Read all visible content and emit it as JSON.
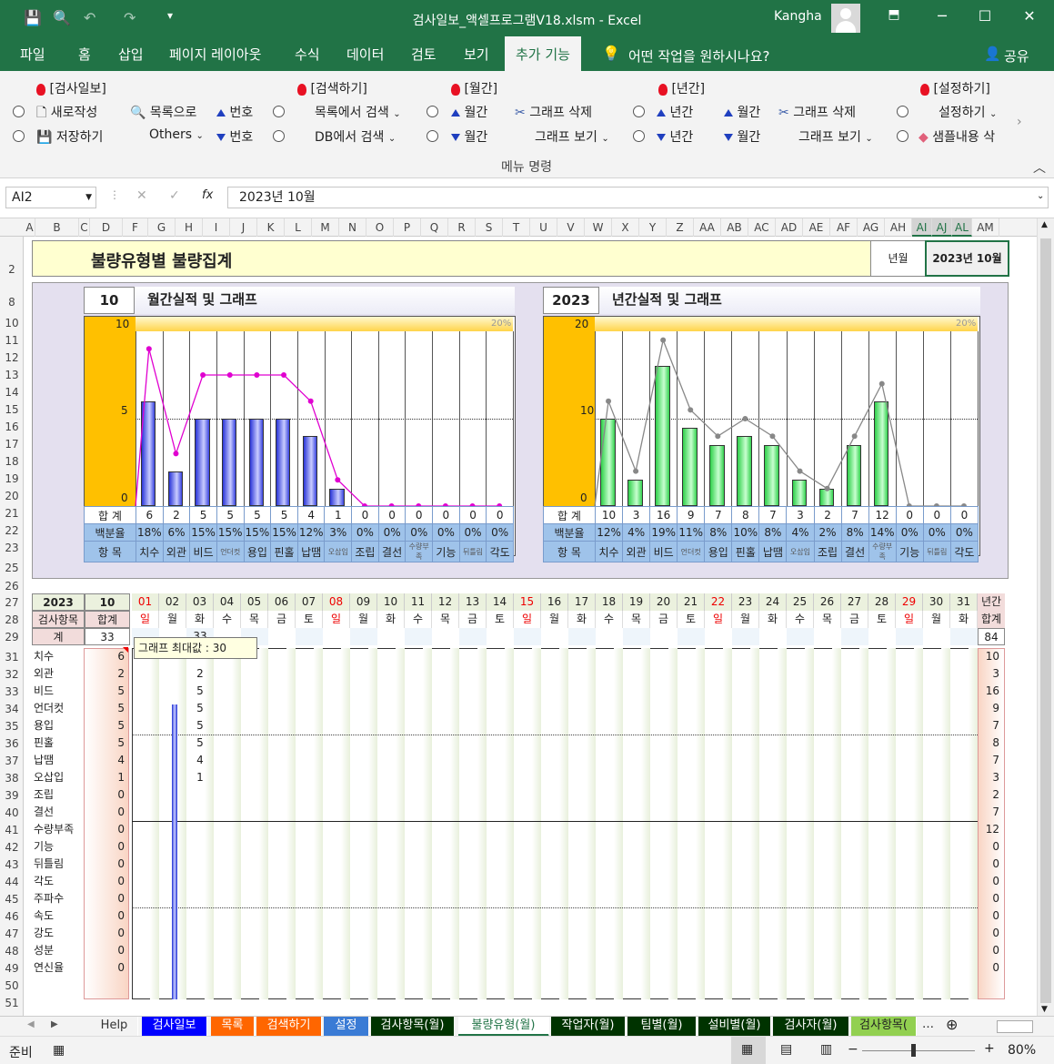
{
  "window": {
    "title": "검사일보_액셀프로그램V18.xlsm  -  Excel",
    "user": "Kangha"
  },
  "ribbon_tabs": [
    "파일",
    "홈",
    "삽입",
    "페이지 레이아웃",
    "수식",
    "데이터",
    "검토",
    "보기",
    "추가 기능"
  ],
  "tell_me": "어떤 작업을 원하시나요?",
  "share": "공유",
  "ribbon": {
    "g1_title": "[검사일보]",
    "new": "새로작성",
    "save": "저장하기",
    "to_list": "목록으로",
    "others": "Others",
    "num_up": "번호",
    "num_dn": "번호",
    "g2_title": "[검색하기]",
    "search_list": "목록에서 검색",
    "search_db": "DB에서 검색",
    "g3_title": "[월간]",
    "m_up": "월간",
    "m_dn": "월간",
    "graph_del": "그래프 삭제",
    "graph_view": "그래프 보기",
    "g4_title": "[년간]",
    "y_up": "년간",
    "y_dn": "년간",
    "ym_up": "월간",
    "ym_dn": "월간",
    "y_graph_del": "그래프 삭제",
    "y_graph_view": "그래프 보기",
    "g5_title": "[설정하기]",
    "settings": "설정하기",
    "sample_del": "샘플내용 삭",
    "footer": "메뉴 명령"
  },
  "formula": {
    "cell": "AI2",
    "value": "2023년 10월",
    "fx": "fx"
  },
  "columns": [
    "A",
    "B",
    "C",
    "D",
    "F",
    "G",
    "H",
    "I",
    "J",
    "K",
    "L",
    "M",
    "N",
    "O",
    "P",
    "Q",
    "R",
    "S",
    "T",
    "U",
    "V",
    "W",
    "X",
    "Y",
    "Z",
    "AA",
    "AB",
    "AC",
    "AD",
    "AE",
    "AF",
    "AG",
    "AH",
    "AI",
    "AJ",
    "AL",
    "AM"
  ],
  "rows": [
    "2",
    "8",
    "10",
    "11",
    "12",
    "13",
    "14",
    "15",
    "16",
    "17",
    "18",
    "19",
    "20",
    "21",
    "22",
    "23",
    "25",
    "26",
    "27",
    "28",
    "29",
    "31",
    "32",
    "33",
    "34",
    "35",
    "36",
    "37",
    "38",
    "39",
    "40",
    "41",
    "42",
    "43",
    "44",
    "45",
    "46",
    "47",
    "48",
    "49",
    "50",
    "51"
  ],
  "header": {
    "title": "불량유형별 불량집계",
    "ym_label": "년월",
    "ym_value": "2023년 10월"
  },
  "monthly": {
    "num": "10",
    "title": "월간실적 및 그래프",
    "ytop": "10",
    "ymid": "5",
    "y0": "0",
    "pct": "20%"
  },
  "yearly": {
    "num": "2023",
    "title": "년간실적 및 그래프",
    "ytop": "20",
    "ymid": "10",
    "y0": "0",
    "pct": "20%"
  },
  "row_labels": {
    "sum": "합 계",
    "pct": "백분율",
    "item": "항 목"
  },
  "chart_data": [
    {
      "type": "bar",
      "title": "월간실적 및 그래프",
      "categories": [
        "치수",
        "외관",
        "비드",
        "언더컷",
        "용입",
        "핀홀",
        "납땜",
        "오삽입",
        "조립",
        "결선",
        "수량부족",
        "기능",
        "뒤틀림",
        "각도"
      ],
      "values": [
        6,
        2,
        5,
        5,
        5,
        5,
        4,
        1,
        0,
        0,
        0,
        0,
        0,
        0
      ],
      "percent": [
        "18%",
        "6%",
        "15%",
        "15%",
        "15%",
        "15%",
        "12%",
        "3%",
        "0%",
        "0%",
        "0%",
        "0%",
        "0%",
        "0%"
      ],
      "ylim": [
        0,
        10
      ]
    },
    {
      "type": "bar",
      "title": "년간실적 및 그래프",
      "categories": [
        "치수",
        "외관",
        "비드",
        "언더컷",
        "용입",
        "핀홀",
        "납땜",
        "오삽입",
        "조립",
        "결선",
        "수량부족",
        "기능",
        "뒤틀림",
        "각도"
      ],
      "values": [
        10,
        3,
        16,
        9,
        7,
        8,
        7,
        3,
        2,
        7,
        12,
        0,
        0,
        0
      ],
      "percent": [
        "12%",
        "4%",
        "19%",
        "11%",
        "8%",
        "10%",
        "8%",
        "4%",
        "2%",
        "8%",
        "14%",
        "0%",
        "0%",
        "0%"
      ],
      "ylim": [
        0,
        20
      ]
    }
  ],
  "table": {
    "year": "2023",
    "month": "10",
    "item_hdr": "검사항목",
    "sum_hdr": "합계",
    "total_label": "계",
    "total": "33",
    "day3_total": "33",
    "year_hdr1": "년간",
    "year_hdr2": "합계",
    "year_total": "84",
    "days": [
      "01",
      "02",
      "03",
      "04",
      "05",
      "06",
      "07",
      "08",
      "09",
      "10",
      "11",
      "12",
      "13",
      "14",
      "15",
      "16",
      "17",
      "18",
      "19",
      "20",
      "21",
      "22",
      "23",
      "24",
      "25",
      "26",
      "27",
      "28",
      "29",
      "30",
      "31"
    ],
    "weekdays": [
      "일",
      "월",
      "화",
      "수",
      "목",
      "금",
      "토",
      "일",
      "월",
      "화",
      "수",
      "목",
      "금",
      "토",
      "일",
      "월",
      "화",
      "수",
      "목",
      "금",
      "토",
      "일",
      "월",
      "화",
      "수",
      "목",
      "금",
      "토",
      "일",
      "월",
      "화"
    ],
    "items": [
      "치수",
      "외관",
      "비드",
      "언더컷",
      "용입",
      "핀홀",
      "납땜",
      "오삽입",
      "조립",
      "결선",
      "수량부족",
      "기능",
      "뒤틀림",
      "각도",
      "주파수",
      "속도",
      "강도",
      "성분",
      "연신율"
    ],
    "monthly_sums": [
      "6",
      "2",
      "5",
      "5",
      "5",
      "5",
      "4",
      "1",
      "0",
      "0",
      "0",
      "0",
      "0",
      "0",
      "0",
      "0",
      "0",
      "0",
      "0"
    ],
    "day3": [
      "",
      "2",
      "5",
      "5",
      "5",
      "5",
      "4",
      "1"
    ],
    "yearly_sums": [
      "10",
      "3",
      "16",
      "9",
      "7",
      "8",
      "7",
      "3",
      "2",
      "7",
      "12",
      "0",
      "0",
      "0",
      "0",
      "0",
      "0",
      "0",
      "0"
    ],
    "tooltip": "그래프 최대값 : 30"
  },
  "sheet_tabs": [
    "Help",
    "검사일보",
    "목록",
    "검색하기",
    "설정",
    "검사항목(월)",
    "불량유형(월)",
    "작업자(월)",
    "팀별(월)",
    "설비별(월)",
    "검사자(월)",
    "검사항목("
  ],
  "status": {
    "ready": "준비",
    "zoom": "80%"
  }
}
